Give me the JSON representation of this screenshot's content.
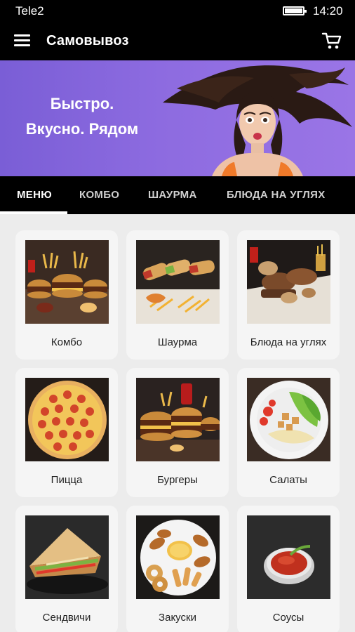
{
  "status_bar": {
    "carrier": "Tele2",
    "time": "14:20"
  },
  "app_bar": {
    "title": "Самовывоз",
    "menu_icon": "menu-icon",
    "cart_icon": "cart-icon"
  },
  "banner": {
    "line1": "Быстро.",
    "line2": "Вкусно. Рядом",
    "accent_color": "#8d6be0"
  },
  "tabs": [
    {
      "label": "МЕНЮ",
      "active": true
    },
    {
      "label": "КОМБО",
      "active": false
    },
    {
      "label": "ШАУРМА",
      "active": false
    },
    {
      "label": "БЛЮДА НА УГЛЯХ",
      "active": false
    }
  ],
  "categories": [
    {
      "label": "Комбо",
      "icon": "combo-photo"
    },
    {
      "label": "Шаурма",
      "icon": "shawarma-photo"
    },
    {
      "label": "Блюда на углях",
      "icon": "grill-photo"
    },
    {
      "label": "Пицца",
      "icon": "pizza-photo"
    },
    {
      "label": "Бургеры",
      "icon": "burgers-photo"
    },
    {
      "label": "Салаты",
      "icon": "salad-photo"
    },
    {
      "label": "Сендвичи",
      "icon": "sandwich-photo"
    },
    {
      "label": "Закуски",
      "icon": "snacks-photo"
    },
    {
      "label": "Соусы",
      "icon": "sauce-photo"
    }
  ]
}
